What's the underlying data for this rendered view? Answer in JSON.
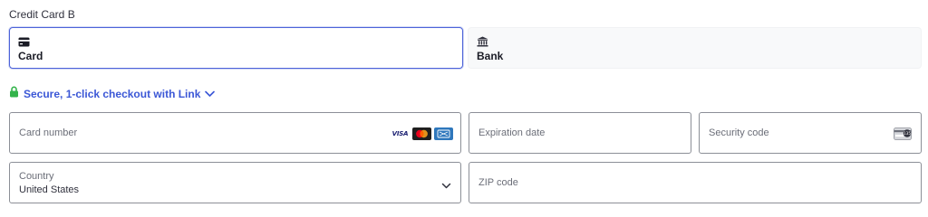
{
  "section": {
    "title": "Credit Card B"
  },
  "tabs": [
    {
      "label": "Card",
      "icon": "card-icon",
      "selected": true
    },
    {
      "label": "Bank",
      "icon": "bank-icon",
      "selected": false
    }
  ],
  "link": {
    "text": "Secure, 1-click checkout with Link",
    "icon": "lock-icon",
    "accent": "#3b57d6",
    "lock_color": "#33b34a"
  },
  "fields": {
    "card_number": {
      "placeholder": "Card number",
      "brands": [
        "VISA",
        "mastercard",
        "amex"
      ]
    },
    "expiration": {
      "placeholder": "Expiration date"
    },
    "security_code": {
      "placeholder": "Security code",
      "icon": "cvc-card-icon",
      "icon_text": "135"
    },
    "country": {
      "label": "Country",
      "value": "United States"
    },
    "zip": {
      "placeholder": "ZIP code"
    }
  },
  "colors": {
    "focus": "#4d63d9",
    "border": "#8c8f97",
    "text": "#30313d"
  }
}
